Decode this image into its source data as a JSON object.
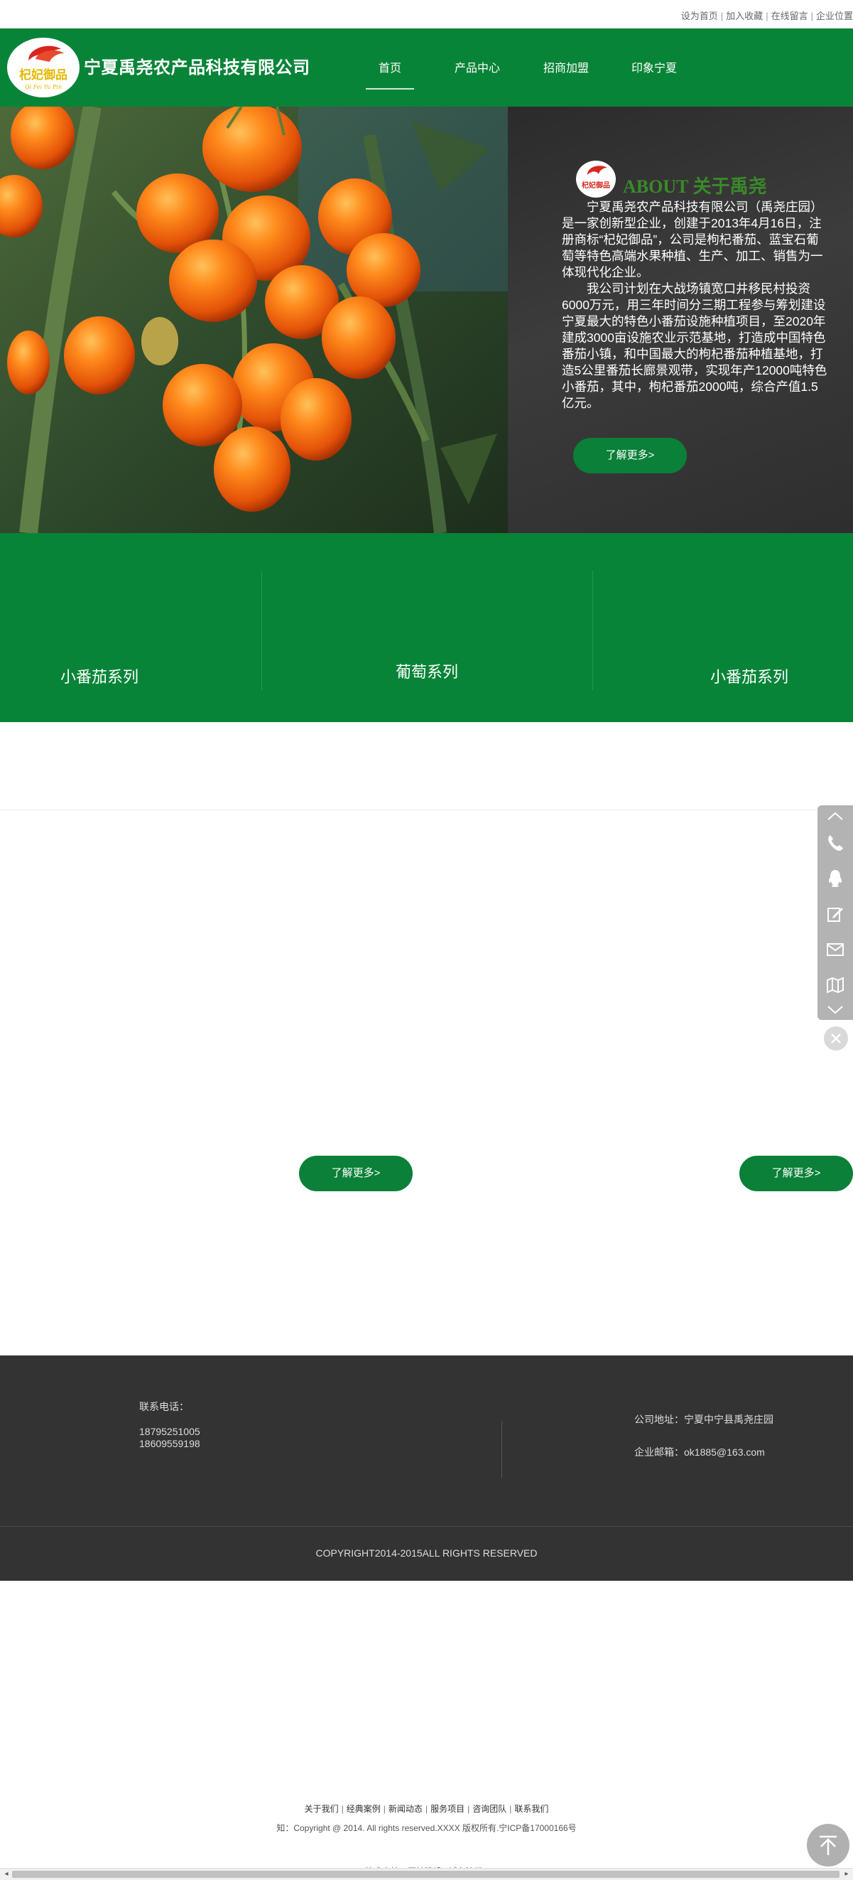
{
  "toplinks": [
    "设为首页",
    "加入收藏",
    "在线留言",
    "企业位置"
  ],
  "header": {
    "company": "宁夏禹尧农产品科技有限公司",
    "logo_text": "杞妃御品",
    "logo_subtext": "Qi Fei Yu Pin"
  },
  "nav": [
    "首页",
    "产品中心",
    "招商加盟",
    "印象宁夏"
  ],
  "about": {
    "title": "ABOUT 关于禹尧",
    "logo_text": "杞妃御品",
    "para1": "宁夏禹尧农产品科技有限公司（禹尧庄园）是一家创新型企业，创建于2013年4月16日，注册商标“杞妃御品”，公司是枸杞番茄、蓝宝石葡萄等特色高端水果种植、生产、加工、销售为一体现代化企业。",
    "para2": "我公司计划在大战场镇宽口井移民村投资6000万元，用三年时间分三期工程参与筹划建设宁夏最大的特色小番茄设施种植项目，至2020年建成3000亩设施农业示范基地，打造成中国特色番茄小镇，和中国最大的枸杞番茄种植基地，打造5公里番茄长廊景观带，实现年产12000吨特色小番茄，其中，枸杞番茄2000吨，综合产值1.5亿元。",
    "button": "了解更多>"
  },
  "series": [
    "小番茄系列",
    "葡萄系列",
    "小番茄系列"
  ],
  "more_buttons": [
    "了解更多>",
    "了解更多>"
  ],
  "footer": {
    "phone_label": "联系电话：",
    "phone1": "18795251005",
    "phone2": "18609559198",
    "address": "公司地址：宁夏中宁县禹尧庄园",
    "email": "企业邮箱：ok1885@163.com",
    "copyright": "COPYRIGHT2014-2015ALL RIGHTS RESERVED"
  },
  "bottom_links": [
    "关于我们",
    "经典案例",
    "新闻动态",
    "服务项目",
    "咨询团队",
    "联系我们"
  ],
  "bottom_copy": "知：Copyright @ 2014. All rights reserved.XXXX 版权所有.宁ICP备17000166号",
  "bottom_cut": "技术支持：网站建设 | 域名注册",
  "colors": {
    "brand_green": "#088438",
    "dark_footer": "#333333"
  }
}
